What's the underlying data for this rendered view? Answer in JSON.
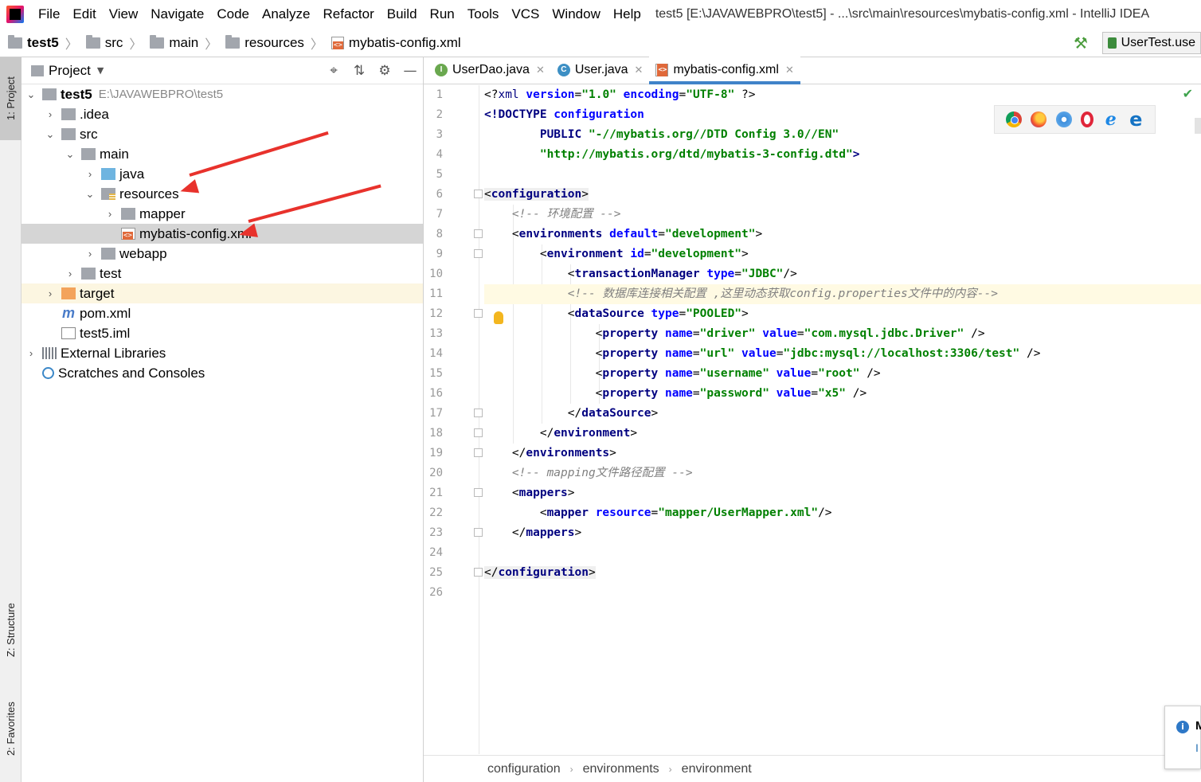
{
  "menu": {
    "items": [
      "File",
      "Edit",
      "View",
      "Navigate",
      "Code",
      "Analyze",
      "Refactor",
      "Build",
      "Run",
      "Tools",
      "VCS",
      "Window",
      "Help"
    ],
    "window_title": "test5 [E:\\JAVAWEBPRO\\test5] - ...\\src\\main\\resources\\mybatis-config.xml - IntelliJ IDEA"
  },
  "breadcrumb": {
    "items": [
      "test5",
      "src",
      "main",
      "resources",
      "mybatis-config.xml"
    ]
  },
  "run_config": {
    "label": "UserTest.use"
  },
  "left_strip": {
    "project": "1: Project",
    "structure": "Z: Structure",
    "favorites": "2: Favorites"
  },
  "project_panel": {
    "title": "Project",
    "tree": [
      {
        "label": "test5",
        "path": "E:\\JAVAWEBPRO\\test5"
      },
      {
        "label": ".idea"
      },
      {
        "label": "src"
      },
      {
        "label": "main"
      },
      {
        "label": "java"
      },
      {
        "label": "resources"
      },
      {
        "label": "mapper"
      },
      {
        "label": "mybatis-config.xml"
      },
      {
        "label": "webapp"
      },
      {
        "label": "test"
      },
      {
        "label": "target"
      },
      {
        "label": "pom.xml"
      },
      {
        "label": "test5.iml"
      },
      {
        "label": "External Libraries"
      },
      {
        "label": "Scratches and Consoles"
      }
    ]
  },
  "tabs": [
    {
      "label": "UserDao.java",
      "icon": "I"
    },
    {
      "label": "User.java",
      "icon": "C"
    },
    {
      "label": "mybatis-config.xml",
      "icon": "xml",
      "active": true
    }
  ],
  "editor": {
    "line_numbers": [
      "1",
      "2",
      "3",
      "4",
      "5",
      "6",
      "7",
      "8",
      "9",
      "10",
      "11",
      "12",
      "13",
      "14",
      "15",
      "16",
      "17",
      "18",
      "19",
      "20",
      "21",
      "22",
      "23",
      "24",
      "25",
      "26"
    ],
    "lines": {
      "l1": {
        "a": "<?",
        "b": "xml",
        "c": " version",
        "d": "=",
        "e": "\"1.0\"",
        "f": " encoding",
        "g": "=",
        "h": "\"UTF-8\"",
        "i": " ?>"
      },
      "l2": {
        "a": "<!DOCTYPE",
        "b": " configuration"
      },
      "l3": {
        "a": "        PUBLIC",
        "b": " \"-//mybatis.org//DTD Config 3.0//EN\""
      },
      "l4": {
        "a": "        \"http://mybatis.org/dtd/mybatis-3-config.dtd\"",
        "b": ">"
      },
      "l6": {
        "a": "<",
        "b": "configuration",
        "c": ">"
      },
      "l7": {
        "a": "    <!-- 环境配置 -->"
      },
      "l8": {
        "a": "    <",
        "b": "environments",
        "c": " default",
        "d": "=",
        "e": "\"development\"",
        "f": ">"
      },
      "l9": {
        "a": "        <",
        "b": "environment",
        "c": " id",
        "d": "=",
        "e": "\"development\"",
        "f": ">"
      },
      "l10": {
        "a": "            <",
        "b": "transactionManager",
        "c": " type",
        "d": "=",
        "e": "\"JDBC\"",
        "f": "/>"
      },
      "l11": {
        "a": "            <!-- 数据库连接相关配置 ,这里动态获取config.properties文件中的内容-->"
      },
      "l12": {
        "a": "            <",
        "b": "dataSource",
        "c": " type",
        "d": "=",
        "e": "\"POOLED\"",
        "f": ">"
      },
      "l13": {
        "a": "                <",
        "b": "property",
        "c": " name",
        "d": "=",
        "e": "\"driver\"",
        "f": " value",
        "g": "=",
        "h": "\"com.mysql.jdbc.Driver\"",
        "i": " />"
      },
      "l14": {
        "a": "                <",
        "b": "property",
        "c": " name",
        "d": "=",
        "e": "\"url\"",
        "f": " value",
        "g": "=",
        "h": "\"jdbc:mysql://localhost:3306/test\"",
        "i": " />"
      },
      "l15": {
        "a": "                <",
        "b": "property",
        "c": " name",
        "d": "=",
        "e": "\"username\"",
        "f": " value",
        "g": "=",
        "h": "\"root\"",
        "i": " />"
      },
      "l16": {
        "a": "                <",
        "b": "property",
        "c": " name",
        "d": "=",
        "e": "\"password\"",
        "f": " value",
        "g": "=",
        "h": "\"x5\"",
        "i": " />"
      },
      "l17": {
        "a": "            </",
        "b": "dataSource",
        "c": ">"
      },
      "l18": {
        "a": "        </",
        "b": "environment",
        "c": ">"
      },
      "l19": {
        "a": "    </",
        "b": "environments",
        "c": ">"
      },
      "l20": {
        "a": "    <!-- mapping文件路径配置 -->"
      },
      "l21": {
        "a": "    <",
        "b": "mappers",
        "c": ">"
      },
      "l22": {
        "a": "        <",
        "b": "mapper",
        "c": " resource",
        "d": "=",
        "e": "\"mapper/UserMapper.xml\"",
        "f": "/>"
      },
      "l23": {
        "a": "    </",
        "b": "mappers",
        "c": ">"
      },
      "l25": {
        "a": "</",
        "b": "configuration",
        "c": ">"
      }
    }
  },
  "status_breadcrumb": [
    "configuration",
    "environments",
    "environment"
  ],
  "notification": {
    "title": "M",
    "link": "I"
  },
  "colors": {
    "tag": "#000080",
    "attr": "#0000ff",
    "value": "#008000",
    "comment": "#808080",
    "annotation_arrow": "#e8322c",
    "selection": "#d5d5d5"
  }
}
